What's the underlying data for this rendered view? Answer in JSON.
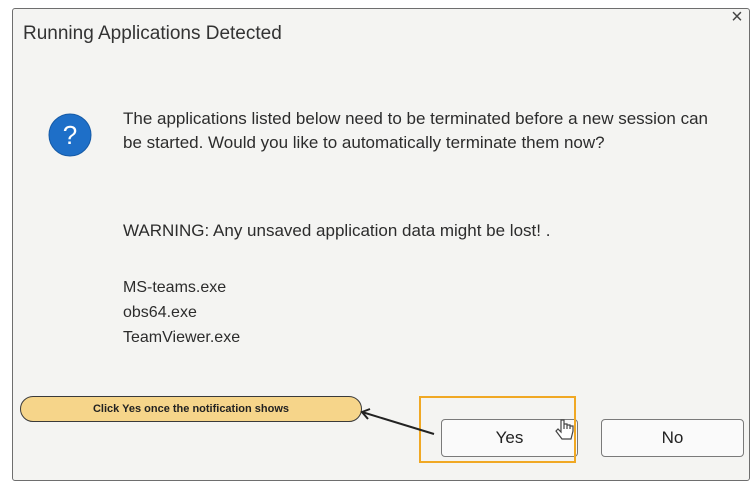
{
  "dialog": {
    "title": "Running Applications Detected",
    "close_label": "×",
    "message": "The applications listed below need to be terminated before a new session can be started. Would you like to automatically terminate them now?",
    "warning": "WARNING: Any unsaved application data might be lost! .",
    "applications": [
      "MS-teams.exe",
      "obs64.exe",
      "TeamViewer.exe"
    ],
    "icon": "question-icon",
    "buttons": {
      "yes": "Yes",
      "no": "No"
    }
  },
  "annotation": {
    "callout_text": "Click Yes once the notification shows"
  },
  "colors": {
    "dialog_bg": "#f4f4f2",
    "icon_blue": "#1e6fc8",
    "callout_fill": "#f6d58a",
    "highlight_border": "#f0a824"
  }
}
